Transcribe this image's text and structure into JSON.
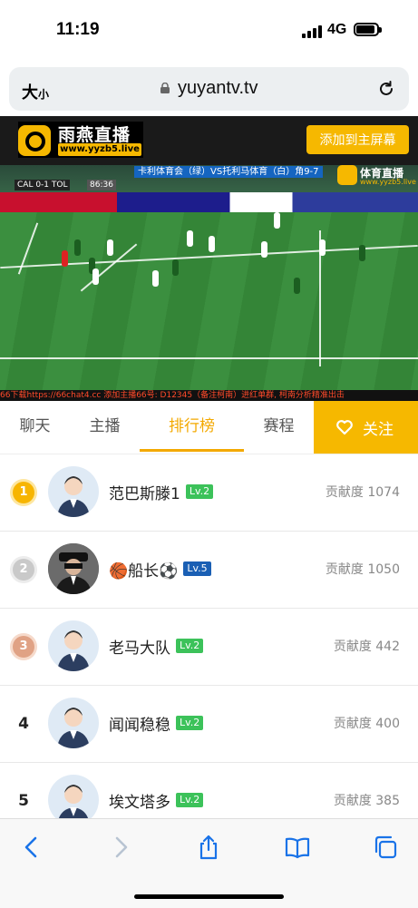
{
  "status_bar": {
    "time": "11:19",
    "network": "4G"
  },
  "browser": {
    "text_size_label": "大",
    "text_size_small": "小",
    "url": "yuyantv.tv"
  },
  "site_header": {
    "logo_text": "雨燕直播",
    "logo_subtext": "www.yyzb5.live",
    "add_home_button": "添加到主屏幕"
  },
  "video": {
    "match_title": "卡利体育会（绿）VS托利马体育（白）角9-7",
    "scoreboard": "CAL 0-1 TOL",
    "clock": "86:36",
    "watermark": "体育直播",
    "watermark_sub": "www.yyzb5.live",
    "ticker": "66下载https://66chat4.cc 添加主播66号: D12345（备注柯南）进红单群, 柯南分析精准出击"
  },
  "tabs": [
    {
      "label": "聊天",
      "active": false
    },
    {
      "label": "主播",
      "active": false
    },
    {
      "label": "排行榜",
      "active": true
    },
    {
      "label": "赛程",
      "active": false
    }
  ],
  "follow_button": "关注",
  "ranking": [
    {
      "rank": "1",
      "name": "范巴斯滕1",
      "level": "Lv.2",
      "level_color": "#3cc25a",
      "contribution": "贡献度 1074"
    },
    {
      "rank": "2",
      "name": "🏀船长⚽",
      "level": "Lv.5",
      "level_color": "#1a5fb4",
      "contribution": "贡献度 1050"
    },
    {
      "rank": "3",
      "name": "老马大队",
      "level": "Lv.2",
      "level_color": "#3cc25a",
      "contribution": "贡献度 442"
    },
    {
      "rank": "4",
      "name": "闻闻稳稳",
      "level": "Lv.2",
      "level_color": "#3cc25a",
      "contribution": "贡献度 400"
    },
    {
      "rank": "5",
      "name": "埃文塔多",
      "level": "Lv.2",
      "level_color": "#3cc25a",
      "contribution": "贡献度 385"
    }
  ],
  "accent_color": "#f6b800"
}
